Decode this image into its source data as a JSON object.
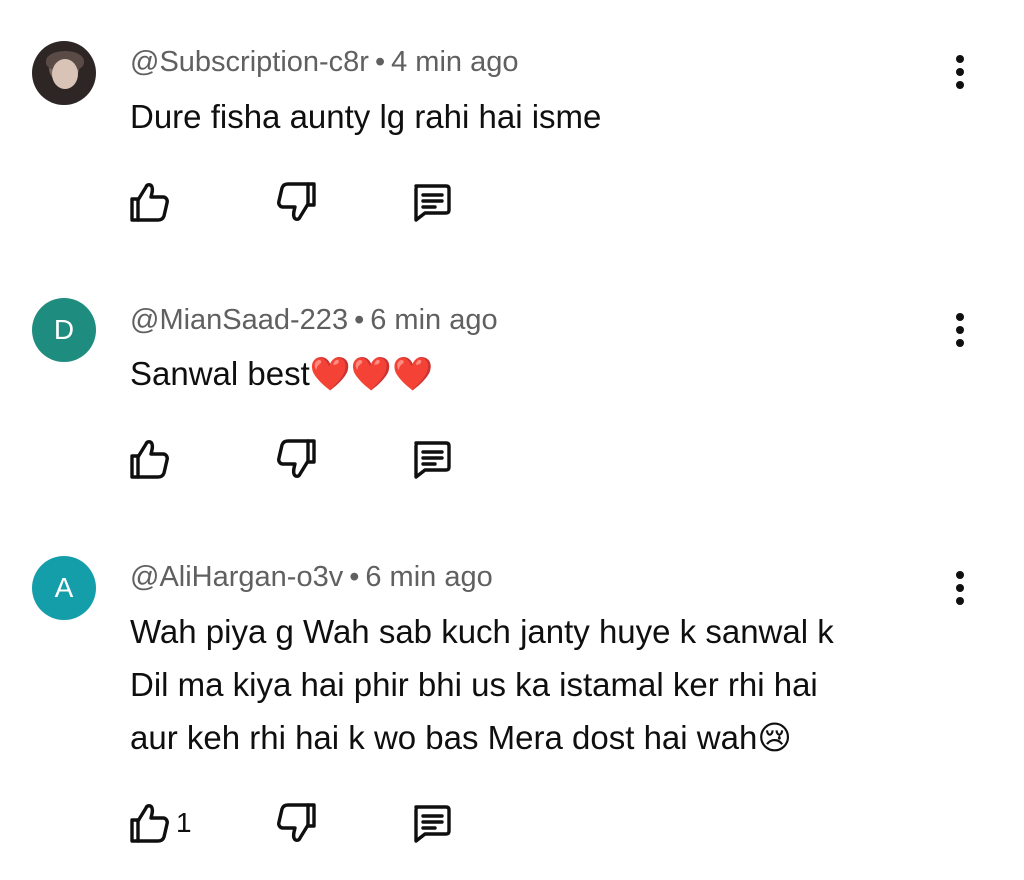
{
  "comments": [
    {
      "handle": "@Subscription-c8r",
      "separator": "•",
      "time": "4 min ago",
      "text_lines": [
        "Dure fisha aunty lg rahi hai isme"
      ],
      "avatar_letter": "",
      "avatar_color": "",
      "like_count": ""
    },
    {
      "handle": "@MianSaad-223",
      "separator": "•",
      "time": "6 min ago",
      "text_lines": [
        "Sanwal best❤️❤️❤️"
      ],
      "avatar_letter": "D",
      "avatar_color": "#1e8c7e",
      "like_count": ""
    },
    {
      "handle": "@AliHargan-o3v",
      "separator": "•",
      "time": "6 min ago",
      "text_lines": [
        "Wah piya g Wah sab kuch janty huye k sanwal k",
        "Dil ma kiya hai phir bhi us ka istamal ker rhi hai",
        "aur keh rhi hai k wo bas Mera dost hai wah😢"
      ],
      "avatar_letter": "A",
      "avatar_color": "#149eaa",
      "like_count": "1"
    }
  ],
  "icons": {
    "like": "thumb-up-icon",
    "dislike": "thumb-down-icon",
    "reply": "comment-icon",
    "more": "more-vert-icon"
  }
}
